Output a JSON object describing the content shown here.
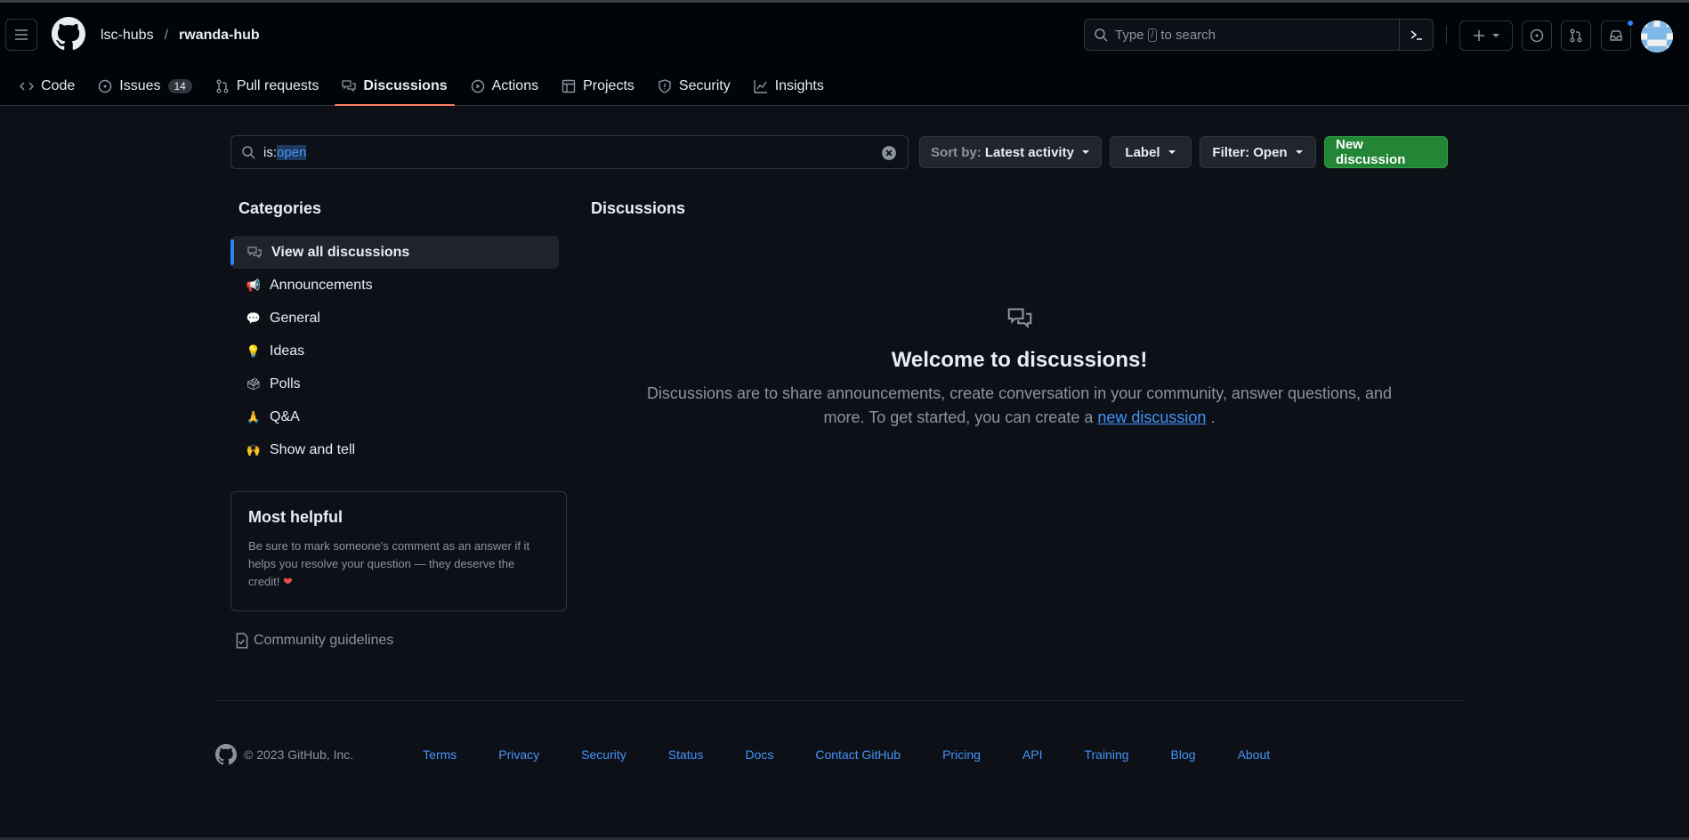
{
  "header": {
    "owner": "lsc-hubs",
    "separator": "/",
    "repo": "rwanda-hub",
    "search_prefix": "Type",
    "search_key": "/",
    "search_suffix": "to search"
  },
  "tabs": [
    {
      "label": "Code",
      "icon": "code-icon"
    },
    {
      "label": "Issues",
      "icon": "issue-icon",
      "count": "14"
    },
    {
      "label": "Pull requests",
      "icon": "pull-request-icon"
    },
    {
      "label": "Discussions",
      "icon": "discussion-icon",
      "selected": true
    },
    {
      "label": "Actions",
      "icon": "play-icon"
    },
    {
      "label": "Projects",
      "icon": "table-icon"
    },
    {
      "label": "Security",
      "icon": "shield-icon"
    },
    {
      "label": "Insights",
      "icon": "graph-icon"
    }
  ],
  "filter": {
    "prefix": "is:",
    "value": "open"
  },
  "toolbar": {
    "sort_prefix": "Sort by:",
    "sort_value": "Latest activity",
    "label": "Label",
    "filter": "Filter: Open",
    "new_discussion": "New discussion"
  },
  "sidebar": {
    "title": "Categories",
    "items": [
      {
        "label": "View all discussions",
        "icon": "discussion-icon",
        "active": true
      },
      {
        "label": "Announcements",
        "icon": "megaphone-icon"
      },
      {
        "label": "General",
        "icon": "speech-balloon-icon"
      },
      {
        "label": "Ideas",
        "icon": "light-bulb-icon"
      },
      {
        "label": "Polls",
        "icon": "ballot-box-icon"
      },
      {
        "label": "Q&A",
        "icon": "praying-hands-icon"
      },
      {
        "label": "Show and tell",
        "icon": "raising-hands-icon"
      }
    ],
    "helpful_title": "Most helpful",
    "helpful_text": "Be sure to mark someone's comment as an answer if it helps you resolve your question — they deserve the credit!",
    "guidelines": "Community guidelines"
  },
  "main": {
    "title": "Discussions",
    "welcome_title": "Welcome to discussions!",
    "welcome_text": "Discussions are to share announcements, create conversation in your community, answer questions, and more. To get started, you can create a",
    "welcome_link": "new discussion",
    "welcome_end": "."
  },
  "footer": {
    "copyright": "© 2023 GitHub, Inc.",
    "links": [
      "Terms",
      "Privacy",
      "Security",
      "Status",
      "Docs",
      "Contact GitHub",
      "Pricing",
      "API",
      "Training",
      "Blog",
      "About"
    ]
  },
  "colors": {
    "accent": "#2f81f7",
    "primary_button": "#238636",
    "selected_tab_underline": "#f78166",
    "background": "#0d1117"
  }
}
